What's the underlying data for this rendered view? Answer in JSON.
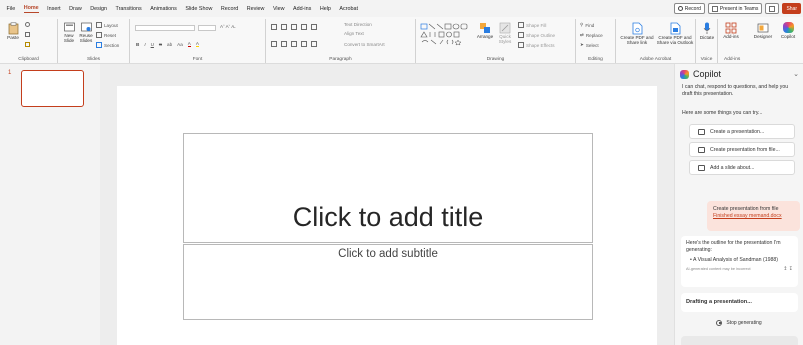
{
  "tabs": [
    "File",
    "Home",
    "Insert",
    "Draw",
    "Design",
    "Transitions",
    "Animations",
    "Slide Show",
    "Record",
    "Review",
    "View",
    "Add-ins",
    "Help",
    "Acrobat"
  ],
  "active_tab": "Home",
  "window_buttons": {
    "record": "Record",
    "present": "Present in Teams",
    "share": "Shar"
  },
  "ribbon": {
    "clipboard": {
      "paste": "Paste",
      "label": "Clipboard"
    },
    "slides": {
      "new_slide": "New Slide",
      "reuse_slides": "Reuse Slides",
      "layout": "Layout",
      "reset": "Reset",
      "section": "Section",
      "label": "Slides"
    },
    "font": {
      "label": "Font",
      "bold": "B",
      "italic": "I",
      "underline": "U",
      "strike": "S",
      "spacing": "ab",
      "case": "Aa"
    },
    "paragraph": {
      "label": "Paragraph",
      "text_direction": "Text Direction",
      "align_text": "Align Text",
      "convert_smartart": "Convert to SmartArt"
    },
    "drawing": {
      "label": "Drawing",
      "arrange": "Arrange",
      "quick_styles": "Quick Styles",
      "shape_fill": "Shape Fill",
      "shape_outline": "Shape Outline",
      "shape_effects": "Shape Effects"
    },
    "editing": {
      "label": "Editing",
      "find": "Find",
      "replace": "Replace",
      "select": "Select"
    },
    "adobe": {
      "label": "Adobe Acrobat",
      "create_pdf": "Create PDF and Share link",
      "create_pdf_outlook": "Create PDF and Share via Outlook"
    },
    "voice": {
      "label": "Voice",
      "dictate": "Dictate"
    },
    "addins": {
      "label": "Add-ins",
      "addins": "Add-ins",
      "designer": "Designer",
      "copilot": "Copilot"
    }
  },
  "thumbnails": {
    "number": "1"
  },
  "slide": {
    "title_placeholder": "Click to add title",
    "subtitle_placeholder": "Click to add subtitle"
  },
  "copilot": {
    "title": "Copilot",
    "intro": "I can chat, respond to questions, and help you draft this presentation.",
    "try_text": "Here are some things you can try...",
    "suggestions": [
      "Create a presentation...",
      "Create presentation from file...",
      "Add a slide about..."
    ],
    "user_message": "Create presentation from file",
    "user_file": "Finished essay memand.docx",
    "outline_intro": "Here's the outline for the presentation I'm generating:",
    "outline_item": "A Visual Analysis of Sandman (1988)",
    "disclaimer": "AI-generated content may be incorrect",
    "drafting": "Drafting a presentation...",
    "stop": "Stop generating"
  },
  "colors": {
    "accent": "#c43e1c",
    "active_tab": "#b7472a",
    "user_bubble": "#fbe3dc"
  }
}
